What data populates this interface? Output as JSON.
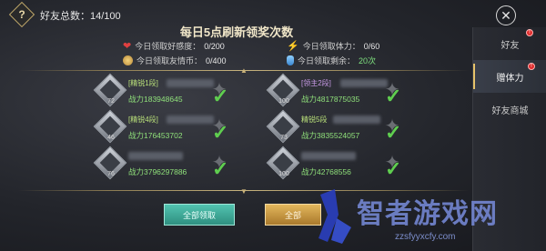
{
  "header": {
    "friend_count_label": "好友总数：14/100",
    "help_icon": "question-mark-icon",
    "close_icon": "close-icon"
  },
  "title": "每日5点刷新领奖次数",
  "stats": {
    "today_affinity_label": "今日领取好感度：",
    "today_affinity_value": "0/200",
    "today_stamina_label": "今日领取体力：",
    "today_stamina_value": "0/60",
    "today_coins_label": "今日领取友情币：",
    "today_coins_value": "0/400",
    "today_remaining_label": "今日领取剩余：",
    "today_remaining_value": "20次"
  },
  "friends": [
    {
      "level": "72",
      "name": "[精锐1段]",
      "power": "战力183948645"
    },
    {
      "level": "100",
      "name": "[领主2段]",
      "power": "战力4817875035"
    },
    {
      "level": "46",
      "name": "[精锐4段]",
      "power": "战力176453702"
    },
    {
      "level": "73",
      "name": "精锐5段",
      "power": "战力3835524057"
    },
    {
      "level": "76",
      "name": "",
      "power": "战力3796297886"
    },
    {
      "level": "100",
      "name": "",
      "power": "战力42768556"
    }
  ],
  "buttons": {
    "claim_all": "全部领取",
    "gift_all": "全部"
  },
  "sidebar": {
    "tabs": [
      {
        "label": "好友",
        "badge": "!"
      },
      {
        "label": "赠体力",
        "badge": "!"
      },
      {
        "label": "好友商城",
        "badge": ""
      }
    ]
  },
  "watermark": {
    "text": "智者游戏网",
    "url": "zzsfyyxcfy.com"
  },
  "colors": {
    "power_green": "#8fe07a",
    "claim_button": "#3fae9c",
    "gift_button": "#d2a24a",
    "badge_red": "#e02a2a"
  }
}
